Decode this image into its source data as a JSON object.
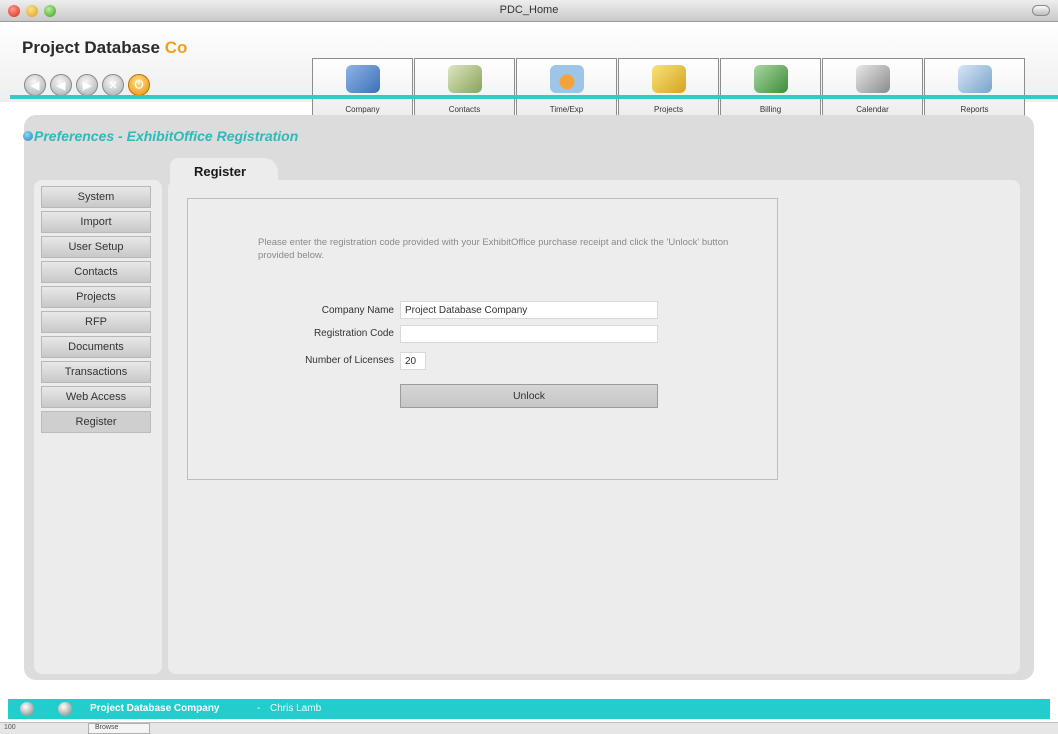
{
  "window": {
    "title": "PDC_Home"
  },
  "brand": {
    "name": "Project Database",
    "suffix": "Co"
  },
  "nav_buttons": [
    "back",
    "back",
    "forward",
    "close",
    "power"
  ],
  "toolbar": [
    {
      "label": "Company",
      "icon": "company-icon"
    },
    {
      "label": "Contacts",
      "icon": "contacts-icon"
    },
    {
      "label": "Time/Exp",
      "icon": "time-exp-icon"
    },
    {
      "label": "Projects",
      "icon": "projects-icon"
    },
    {
      "label": "Billing",
      "icon": "billing-icon"
    },
    {
      "label": "Calendar",
      "icon": "calendar-icon"
    },
    {
      "label": "Reports",
      "icon": "reports-icon"
    }
  ],
  "section": {
    "title": "Preferences - ExhibitOffice Registration"
  },
  "tab": {
    "label": "Register"
  },
  "menu": [
    "System",
    "Import",
    "User Setup",
    "Contacts",
    "Projects",
    "RFP",
    "Documents",
    "Transactions",
    "Web Access",
    "Register"
  ],
  "form": {
    "instructions": "Please enter the registration code provided with your ExhibitOffice purchase receipt and click the 'Unlock' button provided below.",
    "company_label": "Company Name",
    "company_value": "Project Database Company",
    "code_label": "Registration Code",
    "code_value": "",
    "licenses_label": "Number of Licenses",
    "licenses_value": "20",
    "unlock_label": "Unlock"
  },
  "footer": {
    "company": "Project Database Company",
    "separator": "-",
    "user": "Chris Lamb"
  },
  "statusbar": {
    "zoom": "100",
    "mode": "Browse"
  },
  "colors": {
    "accent": "#22cdcd",
    "title": "#2cbaba",
    "brand_co": "#f0a020"
  }
}
